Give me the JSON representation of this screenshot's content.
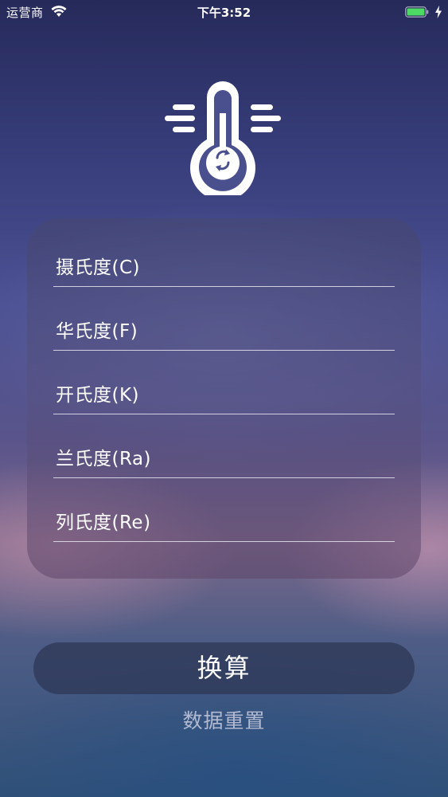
{
  "status_bar": {
    "carrier": "运营商",
    "time": "下午3:52",
    "battery_color": "#4cd964"
  },
  "logo": {
    "icon": "thermometer-convert-icon"
  },
  "form": {
    "fields": [
      {
        "label": "摄氏度(C)",
        "value": ""
      },
      {
        "label": "华氏度(F)",
        "value": ""
      },
      {
        "label": "开氏度(K)",
        "value": ""
      },
      {
        "label": "兰氏度(Ra)",
        "value": ""
      },
      {
        "label": "列氏度(Re)",
        "value": ""
      }
    ]
  },
  "actions": {
    "convert_label": "换算",
    "reset_label": "数据重置"
  }
}
